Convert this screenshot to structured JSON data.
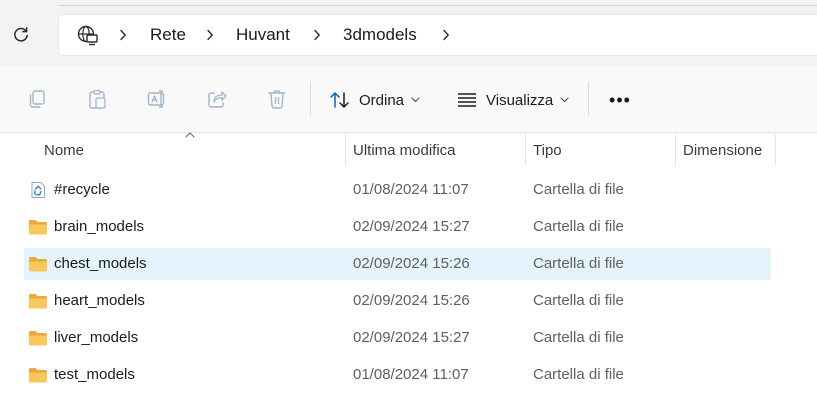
{
  "window": {
    "title": "3dmodels"
  },
  "navigation": {
    "refresh_icon": "refresh-icon",
    "location_icon": "network-computer-icon",
    "breadcrumbs": [
      "Rete",
      "Huvant",
      "3dmodels"
    ],
    "separator_icon": "chevron-right-icon"
  },
  "toolbar": {
    "icons": [
      "copy-icon",
      "paste-icon",
      "rename-icon",
      "share-icon",
      "delete-icon"
    ],
    "sort_label": "Ordina",
    "view_label": "Visualizza",
    "more_label": "•••"
  },
  "columns": {
    "name": "Nome",
    "modified": "Ultima modifica",
    "type": "Tipo",
    "size": "Dimensione"
  },
  "files": [
    {
      "name": "#recycle",
      "modified": "01/08/2024 11:07",
      "type": "Cartella di file",
      "size": "",
      "icon": "recycle-folder-icon",
      "selected": false
    },
    {
      "name": "brain_models",
      "modified": "02/09/2024 15:27",
      "type": "Cartella di file",
      "size": "",
      "icon": "folder-icon",
      "selected": false
    },
    {
      "name": "chest_models",
      "modified": "02/09/2024 15:26",
      "type": "Cartella di file",
      "size": "",
      "icon": "folder-icon",
      "selected": true
    },
    {
      "name": "heart_models",
      "modified": "02/09/2024 15:26",
      "type": "Cartella di file",
      "size": "",
      "icon": "folder-icon",
      "selected": false
    },
    {
      "name": "liver_models",
      "modified": "02/09/2024 15:27",
      "type": "Cartella di file",
      "size": "",
      "icon": "folder-icon",
      "selected": false
    },
    {
      "name": "test_models",
      "modified": "01/08/2024 11:07",
      "type": "Cartella di file",
      "size": "",
      "icon": "folder-icon",
      "selected": false
    }
  ],
  "colors": {
    "selection": "#e5f3fd",
    "folder": "#f8c95a",
    "accent": "#0067c0",
    "disabled_icon": "#9fb6cc"
  }
}
